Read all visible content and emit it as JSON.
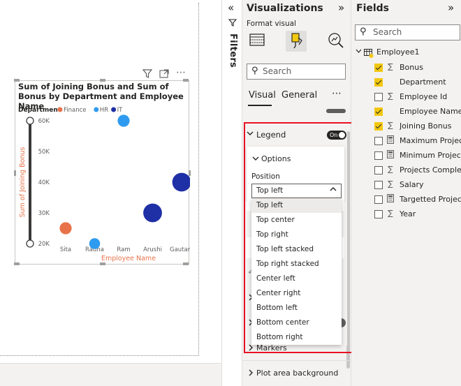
{
  "visual": {
    "title": "Sum of Joining Bonus and Sum of Bonus by Department and Employee Name",
    "toolbar": {
      "filter_icon": "filter-icon",
      "focus_icon": "focus-mode-icon",
      "more": "⋯"
    }
  },
  "chart_data": {
    "type": "scatter",
    "title": "Sum of Joining Bonus and Sum of Bonus by Department and Employee Name",
    "legend_title": "Department",
    "legend": [
      {
        "name": "Finance",
        "color": "#e8734a"
      },
      {
        "name": "HR",
        "color": "#2f9bf0"
      },
      {
        "name": "IT",
        "color": "#1f2fa6"
      }
    ],
    "legend_position": "top-left",
    "categories": [
      "Sita",
      "Radha",
      "Ram",
      "Arushi",
      "Gautam"
    ],
    "xlabel": "Employee Name",
    "ylabel": "Sum of Joining Bonus",
    "yticks": [
      "20K",
      "30K",
      "40K",
      "50K",
      "60K"
    ],
    "ylim": [
      20000,
      60000
    ],
    "points": [
      {
        "x": "Sita",
        "y": 25000,
        "department": "Finance",
        "size": 0.35
      },
      {
        "x": "Radha",
        "y": 20000,
        "department": "HR",
        "size": 0.3
      },
      {
        "x": "Ram",
        "y": 60000,
        "department": "HR",
        "size": 0.35
      },
      {
        "x": "Arushi",
        "y": 30000,
        "department": "IT",
        "size": 0.65
      },
      {
        "x": "Gautam",
        "y": 40000,
        "department": "IT",
        "size": 0.65
      }
    ],
    "y_slider_range": [
      20000,
      60000
    ]
  },
  "filters": {
    "label": "Filters"
  },
  "viz": {
    "title": "Visualizations",
    "subtitle": "Format visual",
    "search_placeholder": "Search",
    "tabs": [
      "Visual",
      "General"
    ],
    "more": "⋯",
    "legend": {
      "label": "Legend",
      "toggle": "On",
      "options_label": "Options",
      "position_label": "Position",
      "position_value": "Top left",
      "options": [
        "Top left",
        "Top center",
        "Top right",
        "Top left stacked",
        "Top right stacked",
        "Center left",
        "Center right",
        "Bottom left",
        "Bottom center",
        "Bottom right"
      ]
    },
    "markers_label": "Markers",
    "plot_area_label": "Plot area background"
  },
  "fields": {
    "title": "Fields",
    "search_placeholder": "Search",
    "table_name": "Employee1",
    "items": [
      {
        "name": "Bonus",
        "checked": true,
        "icon": "sigma-icon"
      },
      {
        "name": "Department",
        "checked": true,
        "icon": "none"
      },
      {
        "name": "Employee Id",
        "checked": false,
        "icon": "sigma-icon"
      },
      {
        "name": "Employee Name",
        "checked": true,
        "icon": "none"
      },
      {
        "name": "Joining Bonus",
        "checked": true,
        "icon": "sigma-icon"
      },
      {
        "name": "Maximum Projects",
        "checked": false,
        "icon": "calculator-icon"
      },
      {
        "name": "Minimum Projects",
        "checked": false,
        "icon": "calculator-icon"
      },
      {
        "name": "Projects Complet...",
        "checked": false,
        "icon": "sigma-icon"
      },
      {
        "name": "Salary",
        "checked": false,
        "icon": "sigma-icon"
      },
      {
        "name": "Targetted Projects",
        "checked": false,
        "icon": "calculator-icon"
      },
      {
        "name": "Year",
        "checked": false,
        "icon": "sigma-icon"
      }
    ]
  }
}
